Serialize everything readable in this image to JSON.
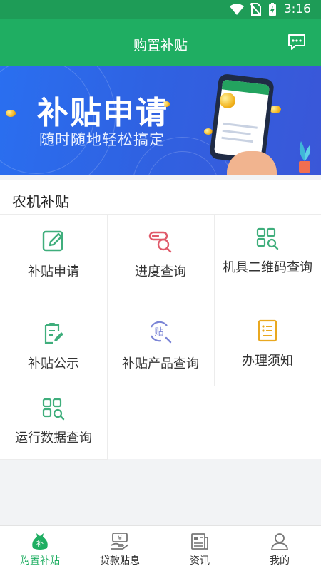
{
  "status_bar": {
    "time": "3:16"
  },
  "header": {
    "title": "购置补贴"
  },
  "banner": {
    "title": "补贴申请",
    "subtitle": "随时随地轻松搞定"
  },
  "section": {
    "title": "农机补贴",
    "items": [
      {
        "label": "补贴申请",
        "icon": "edit-icon"
      },
      {
        "label": "进度查询",
        "icon": "progress-search-icon"
      },
      {
        "label": "机具二维码查询",
        "icon": "qr-search-icon"
      },
      {
        "label": "补贴公示",
        "icon": "clipboard-edit-icon"
      },
      {
        "label": "补贴产品查询",
        "icon": "subsidy-search-icon"
      },
      {
        "label": "办理须知",
        "icon": "notice-doc-icon"
      },
      {
        "label": "运行数据查询",
        "icon": "data-search-icon"
      }
    ]
  },
  "tabbar": {
    "items": [
      {
        "label": "购置补贴",
        "icon": "subsidy-bag-icon",
        "active": true,
        "badge": "补"
      },
      {
        "label": "贷款贴息",
        "icon": "loan-icon",
        "active": false
      },
      {
        "label": "资讯",
        "icon": "news-icon",
        "active": false
      },
      {
        "label": "我的",
        "icon": "profile-icon",
        "active": false
      }
    ]
  },
  "colors": {
    "brand_green": "#1fae62",
    "icon_green": "#3fae7c",
    "icon_red": "#e05a6a",
    "icon_purple": "#7a84d6",
    "icon_gold": "#e9a820",
    "banner_blue": "#2f62e2"
  }
}
